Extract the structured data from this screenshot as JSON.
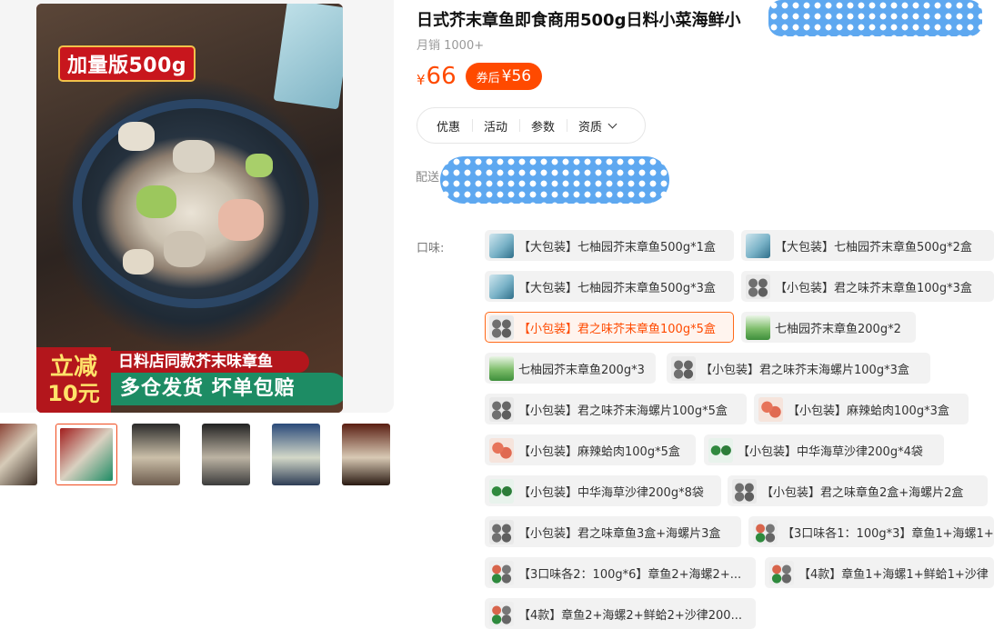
{
  "gallery": {
    "promo_badge": "加量版500g",
    "discount_top": "立减",
    "discount_bottom": "10元",
    "strip_1": "日料店同款芥末味章鱼",
    "strip_2": "多仓发货 坏单包赔",
    "thumb_count": 7,
    "active_thumb_index": 1
  },
  "product": {
    "title": "日式芥末章鱼即食商用500g日料小菜海鲜小",
    "monthly_sales": "月销 1000+",
    "price_symbol": "¥",
    "price": "66",
    "coupon_label": "券后",
    "coupon_price": "¥56"
  },
  "tabs": [
    "优惠",
    "活动",
    "参数",
    "资质"
  ],
  "delivery_label": "配送",
  "flavor_label": "口味:",
  "skus": [
    {
      "label": "【大包装】七柚园芥末章鱼500g*1盒",
      "thumb": "teal"
    },
    {
      "label": "【大包装】七柚园芥末章鱼500g*2盒",
      "thumb": "teal"
    },
    {
      "label": "【大包装】七柚园芥末章鱼500g*3盒",
      "thumb": "teal"
    },
    {
      "label": "【小包装】君之味芥末章鱼100g*3盒",
      "thumb": "round"
    },
    {
      "label": "【小包装】君之味芥末章鱼100g*5盒",
      "thumb": "round",
      "selected": true
    },
    {
      "label": "七柚园芥末章鱼200g*2",
      "thumb": "green"
    },
    {
      "label": "七柚园芥末章鱼200g*3",
      "thumb": "green"
    },
    {
      "label": "【小包装】君之味芥末海螺片100g*3盒",
      "thumb": "round"
    },
    {
      "label": "【小包装】君之味芥末海螺片100g*5盒",
      "thumb": "round"
    },
    {
      "label": "【小包装】麻辣蛤肉100g*3盒",
      "thumb": "red"
    },
    {
      "label": "【小包装】麻辣蛤肉100g*5盒",
      "thumb": "red"
    },
    {
      "label": "【小包装】中华海草沙律200g*4袋",
      "thumb": "seaweed"
    },
    {
      "label": "【小包装】中华海草沙律200g*8袋",
      "thumb": "seaweed"
    },
    {
      "label": "【小包装】君之味章鱼2盒+海螺片2盒",
      "thumb": "round"
    },
    {
      "label": "【小包装】君之味章鱼3盒+海螺片3盒",
      "thumb": "round"
    },
    {
      "label": "【3口味各1：100g*3】章鱼1+海螺1+",
      "thumb": "mixed"
    },
    {
      "label": "【3口味各2：100g*6】章鱼2+海螺2+...",
      "thumb": "mixed"
    },
    {
      "label": "【4款】章鱼1+海螺1+鲜蛤1+沙律",
      "thumb": "mixed"
    },
    {
      "label": "【4款】章鱼2+海螺2+鲜蛤2+沙律200...",
      "thumb": "mixed"
    }
  ],
  "colors": {
    "accent": "#ff4a00",
    "badge_red": "#c8161d",
    "banner_green": "#1d8c64"
  }
}
